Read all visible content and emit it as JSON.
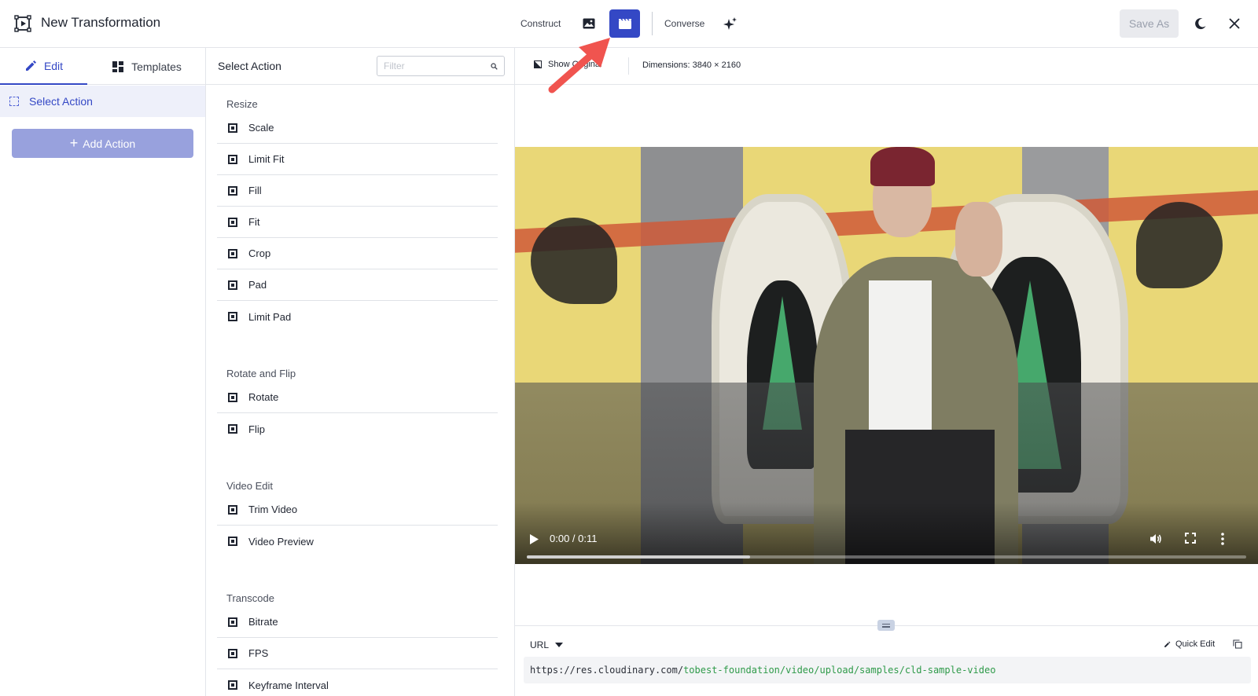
{
  "app": {
    "title": "New Transformation",
    "logo_icon": "video-transform-icon"
  },
  "toolbar": {
    "construct_label": "Construct",
    "converse_label": "Converse",
    "save_as_label": "Save As",
    "active_mode": "video",
    "accent_color": "#3448c5"
  },
  "left_panel": {
    "tabs": [
      {
        "label": "Edit",
        "icon": "pencil-icon",
        "active": true
      },
      {
        "label": "Templates",
        "icon": "templates-grid-icon",
        "active": false
      }
    ],
    "selected_action": "Select Action",
    "add_action_label": "Add Action"
  },
  "middle_panel": {
    "title": "Select Action",
    "filter_placeholder": "Filter",
    "groups": [
      {
        "name": "Resize",
        "items": [
          "Scale",
          "Limit Fit",
          "Fill",
          "Fit",
          "Crop",
          "Pad",
          "Limit Pad"
        ]
      },
      {
        "name": "Rotate and Flip",
        "items": [
          "Rotate",
          "Flip"
        ]
      },
      {
        "name": "Video Edit",
        "items": [
          "Trim Video",
          "Video Preview"
        ]
      },
      {
        "name": "Transcode",
        "items": [
          "Bitrate",
          "FPS",
          "Keyframe Interval"
        ]
      }
    ]
  },
  "preview": {
    "show_original_label": "Show Original",
    "dimensions_label": "Dimensions: 3840 × 2160",
    "video": {
      "time_label": "0:00 / 0:11",
      "progress": 0.31
    },
    "url_mode_label": "URL",
    "quick_edit_label": "Quick Edit",
    "url_prefix": "https://res.cloudinary.com/",
    "url_path": "tobest-foundation/video/upload/samples/cld-sample-video"
  }
}
